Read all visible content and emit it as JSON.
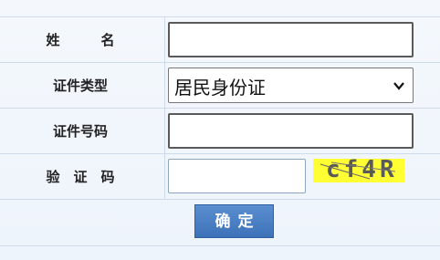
{
  "form": {
    "name_label": "姓　　　名",
    "id_type_label": "证件类型",
    "id_type_selected": "居民身份证",
    "id_number_label": "证件号码",
    "captcha_label": "验　证　码",
    "captcha_text": "cf4R",
    "confirm_label": "确定"
  },
  "icons": {
    "select_arrow": "chevron-down-icon"
  },
  "colors": {
    "button": "#4a80c4",
    "captcha_bg": "#ffff33",
    "grid_line": "#cfdbe9"
  }
}
